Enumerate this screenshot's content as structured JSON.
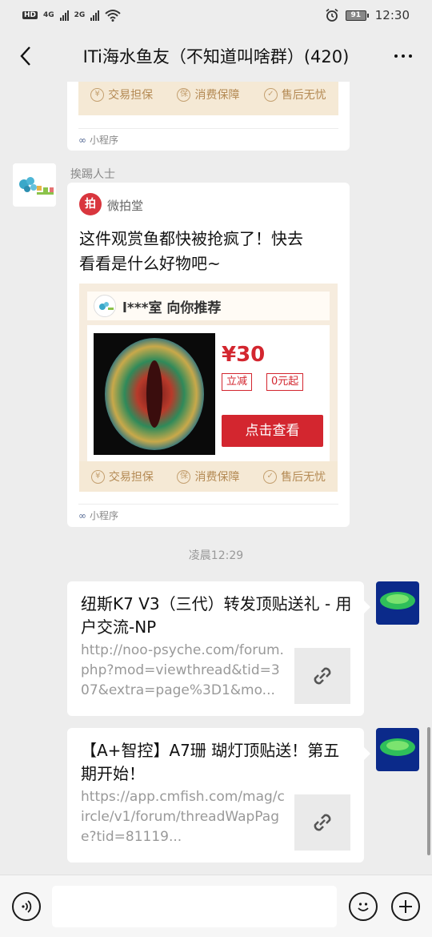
{
  "status_bar": {
    "hd": "HD",
    "net1": "4G",
    "net2": "2G",
    "battery": "91",
    "time": "12:30"
  },
  "nav": {
    "title": "ITi海水鱼友（不知道叫啥群）(420)"
  },
  "assurances": [
    "交易担保",
    "消费保障",
    "售后无忧"
  ],
  "mini_program_label": "小程序",
  "message_card": {
    "sender": "挨踢人士",
    "source_name": "微拍堂",
    "title_line1": "这件观赏鱼都快被抢疯了！快去",
    "title_line2": "看看是什么好物吧~",
    "promo_header": "l***室 向你推荐",
    "price": "¥30",
    "badge1": "立减",
    "badge2": "0元起",
    "button": "点击查看"
  },
  "timestamp": "凌晨12:29",
  "link_messages": [
    {
      "title": "纽斯K7 V3（三代）转发顶贴送礼 - 用户交流-NP",
      "url": "http://noo-psyche.com/forum.php?mod=viewthread&tid=307&extra=page%3D1&mo..."
    },
    {
      "title": "【A+智控】A7珊 瑚灯顶贴送！第五期开始！",
      "url": "https://app.cmfish.com/mag/circle/v1/forum/threadWapPage?tid=81119..."
    }
  ],
  "colors": {
    "price_red": "#d3262f",
    "chat_bg": "#ededed"
  },
  "icons": {
    "voice": "voice-icon",
    "emoji": "emoji-icon",
    "plus": "plus-icon",
    "link": "link-icon"
  }
}
